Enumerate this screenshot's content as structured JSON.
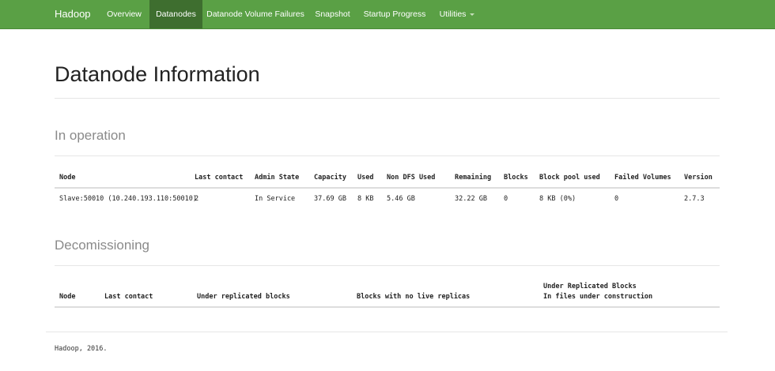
{
  "nav": {
    "brand": "Hadoop",
    "items": [
      {
        "label": "Overview",
        "active": false
      },
      {
        "label": "Datanodes",
        "active": true
      },
      {
        "label": "Datanode Volume Failures",
        "active": false
      },
      {
        "label": "Snapshot",
        "active": false
      },
      {
        "label": "Startup Progress",
        "active": false
      },
      {
        "label": "Utilities",
        "active": false,
        "dropdown": true
      }
    ]
  },
  "page_title": "Datanode Information",
  "in_operation": {
    "title": "In operation",
    "headers": [
      "Node",
      "Last contact",
      "Admin State",
      "Capacity",
      "Used",
      "Non DFS Used",
      "Remaining",
      "Blocks",
      "Block pool used",
      "Failed Volumes",
      "Version"
    ],
    "rows": [
      [
        "Slave:50010 (10.240.193.110:50010)",
        "2",
        "In Service",
        "37.69 GB",
        "8 KB",
        "5.46 GB",
        "32.22 GB",
        "0",
        "8 KB (0%)",
        "0",
        "2.7.3"
      ]
    ]
  },
  "decommissioning": {
    "title": "Decomissioning",
    "headers": [
      "Node",
      "Last contact",
      "Under replicated blocks",
      "Blocks with no live replicas",
      "Under Replicated Blocks",
      "In files under construction"
    ]
  },
  "footer": "Hadoop, 2016.",
  "colors": {
    "navbar": "#5aa045",
    "nav_active": "#3e6e2f"
  }
}
